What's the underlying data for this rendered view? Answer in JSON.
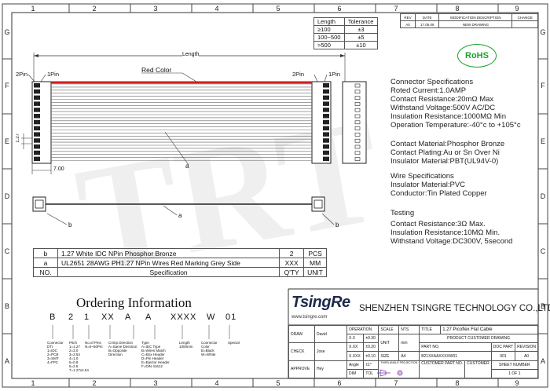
{
  "zones": {
    "columns": [
      "1",
      "2",
      "3",
      "4",
      "5",
      "6",
      "7",
      "8",
      "9"
    ],
    "rows": [
      "G",
      "F",
      "E",
      "D",
      "C",
      "B",
      "A"
    ]
  },
  "length_table": {
    "headers": [
      "Length",
      "Tolerance"
    ],
    "rows": [
      [
        "≥100",
        "±3"
      ],
      [
        "100~500",
        "±5"
      ],
      [
        ">500",
        "±10"
      ]
    ]
  },
  "revision_table": {
    "headers": [
      "REV",
      "DATE",
      "MODIFICATION DESCRIPTION",
      "CHANGE"
    ],
    "rows": [
      [
        "A0",
        "17.05.08",
        "NEW DRAWING",
        ""
      ]
    ]
  },
  "rohs": "RoHS",
  "drawing": {
    "length_label": "Length",
    "red_color_label": "Red Color",
    "pin2_left": "2Pin",
    "pin1_left": "1Pin",
    "pin2_right": "2Pin",
    "pin1_right": "1Pin",
    "pitch": "1.27",
    "width": "7.00",
    "callout_a": "a",
    "callout_b_left": "b",
    "callout_b_right": "b"
  },
  "watermark": "TRT",
  "specs": {
    "connector": [
      "Connector Specifications",
      "Roted Current:1.0AMP",
      "Contact Resistance:20mΩ Max",
      "Withstand Voltage:500V AC/DC",
      "Insulation Resistance:1000MΩ Min",
      "Operation Temperature:-40°c to +105°c"
    ],
    "material": [
      "Contact Material:Phosphor Bronze",
      "Contact Plating:Au or Sn Over Ni",
      "Insulator Material:PBT(UL94V-0)"
    ],
    "wire": [
      "Wire Specifications",
      "Insulator Material:PVC",
      "Conductor:Tin Plated Copper"
    ],
    "testing": [
      "Testing",
      "Contact Resistance:3Ω Max.",
      "Insulation Resistance:10MΩ Min.",
      "Withstand Voltage:DC300V, 5second"
    ]
  },
  "bom": {
    "rows": [
      [
        "b",
        "1.27 White IDC NPin Phosphor Bronze",
        "2",
        "PCS"
      ],
      [
        "a",
        "UL2651 28AWG PH1.27 NPin Wires Red Marking Grey Side",
        "XXX",
        "MM"
      ],
      [
        "NO.",
        "Specification",
        "Q'TY",
        "UNIT"
      ]
    ]
  },
  "ordering": {
    "title": "Ordering Information",
    "code": [
      "B",
      "2",
      "1",
      "XX",
      "A",
      "A",
      "XXXX",
      "W",
      "01"
    ],
    "legends": [
      "Connector DTI\n1=IDC\n2=PCB\n3=SMT\n4=FPC",
      "Pitch\n1=1.27\n2=2.0\n3=2.54\n4=1.0\n5=0.8\n6=2.5\n7=1.27x2.54",
      "No.of Pins\nN=6~50Pin",
      "Crimp Direction\nA=Same Direction\nB=Opposite Direction",
      "Type\nA=IDC Type\nB=Wires Match\nC=Box Header\nD=Pin Header\nE=Ejector Header\nF=DIN 41612",
      "Length\n1000mm",
      "Connector Color\nB=Black\nW=White",
      "Special"
    ]
  },
  "company": {
    "logo": "TsingRe",
    "website": "www.tsingre.com",
    "name": "SHENZHEN TSINGRE TECHNOLOGY CO.,LTD"
  },
  "title_block": {
    "draw_label": "DRAW",
    "draw_name": "David",
    "check_label": "CHECK",
    "check_name": "Jose",
    "approve_label": "APPROVE",
    "approve_name": "Hey",
    "operation_label": "OPERATION",
    "x_x": "X.X",
    "x_x_tol": "±0.30",
    "x_xx": "X.XX",
    "x_xx_tol": "±0.20",
    "x_xxx": "X.XXX",
    "x_xxx_tol": "±0.10",
    "angle": "Angle",
    "angle_tol": "±1°",
    "dim": "DIM",
    "tol": "TOL",
    "scale_label": "SCALE",
    "scale_value": "NTS",
    "unit_label": "UNIT",
    "unit_value": "mm",
    "size_label": "SIZE",
    "size_value": "A4",
    "third_angle": "THIRD ANGLE PROJECTION",
    "title_label": "TITLE",
    "title_value": "1.27 Picoflex Flat Cable",
    "product_drawing": "PRODUCT CUSTOMER DRAWING",
    "part_no_label": "PART NO.",
    "part_no": "B21XXAAXXXXW01",
    "doc_part_label": "DOC PART",
    "doc_part": "001",
    "revision_label": "REVISION",
    "revision": "A0",
    "customer_part_label": "CUSTOMER PART NO.",
    "customer_label": "CUSTOMER",
    "sheet_label": "SHEET NUMBER",
    "sheet": "1 OF 1"
  },
  "colors": {
    "red_wire": "#d21d1d",
    "rohs": "#1aa32b",
    "third_angle": "#7a2fb5",
    "logo": "#1c2a4a"
  }
}
